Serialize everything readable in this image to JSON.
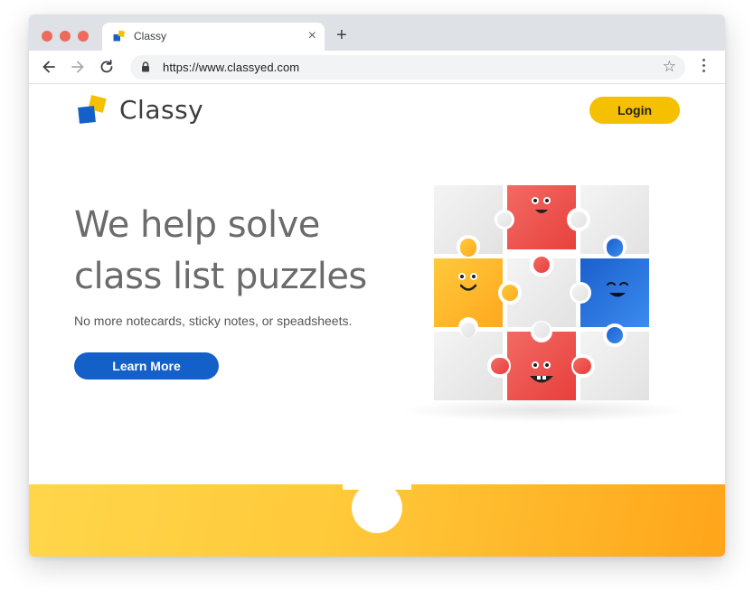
{
  "browser": {
    "tab_title": "Classy",
    "tab_close": "×",
    "new_tab": "+",
    "url": "https://www.classyed.com",
    "star": "☆",
    "traffic_light_color": "#ed6a5e"
  },
  "header": {
    "brand": "Classy",
    "login_label": "Login"
  },
  "hero": {
    "headline": "We help solve class list puzzles",
    "subline": "No more notecards, sticky notes, or speadsheets.",
    "cta_label": "Learn More"
  },
  "colors": {
    "login_button": "#f5c000",
    "cta_button": "#1460c9",
    "puzzle_red": "#f0544f",
    "puzzle_yellow": "#ffbd2e",
    "puzzle_blue": "#1f6fd6",
    "puzzle_gray": "#e9e9e9",
    "footer": "#ffc93a"
  },
  "icons": {
    "back": "arrow-left-icon",
    "forward": "arrow-right-icon",
    "reload": "reload-icon",
    "lock": "lock-icon",
    "bookmark": "star-icon",
    "menu": "kebab-menu-icon"
  }
}
